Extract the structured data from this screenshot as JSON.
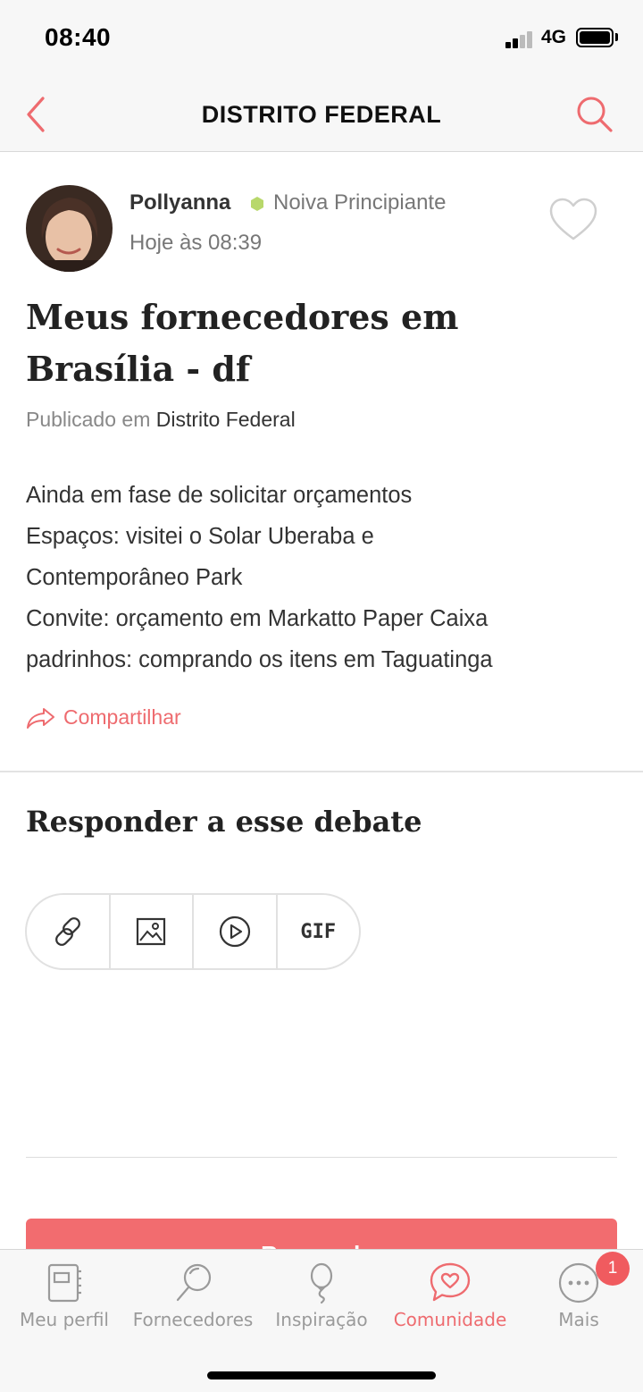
{
  "status_bar": {
    "time": "08:40",
    "network": "4G"
  },
  "nav": {
    "title": "DISTRITO FEDERAL",
    "back_icon": "chevron-left-icon",
    "search_icon": "search-icon"
  },
  "post": {
    "author": "Pollyanna",
    "rank": "Noiva Principiante",
    "time": "Hoje às 08:39",
    "title": "Meus fornecedores em Brasília - df",
    "published_prefix": "Publicado em",
    "forum": "Distrito Federal",
    "body_lines": [
      "Ainda em fase de solicitar orçamentos",
      "Espaços: visitei o Solar Uberaba e",
      "Contemporâneo Park",
      "Convite: orçamento em Markatto Paper Caixa",
      "padrinhos: comprando os itens em Taguatinga"
    ],
    "share_label": "Compartilhar"
  },
  "reply": {
    "title": "Responder a esse debate",
    "tools": {
      "gif_label": "GIF"
    },
    "submit_label": "Responder"
  },
  "tab_bar": {
    "tabs": [
      {
        "label": "Meu perfil",
        "icon": "notebook-icon"
      },
      {
        "label": "Fornecedores",
        "icon": "magnifier-icon"
      },
      {
        "label": "Inspiração",
        "icon": "balloon-icon"
      },
      {
        "label": "Comunidade",
        "icon": "chat-heart-icon"
      },
      {
        "label": "Mais",
        "icon": "more-dots-icon"
      }
    ],
    "badge": "1"
  },
  "colors": {
    "accent": "#ee6b6f",
    "rank_dot": "#b8d86b",
    "bar_bg": "#f7f7f7"
  }
}
